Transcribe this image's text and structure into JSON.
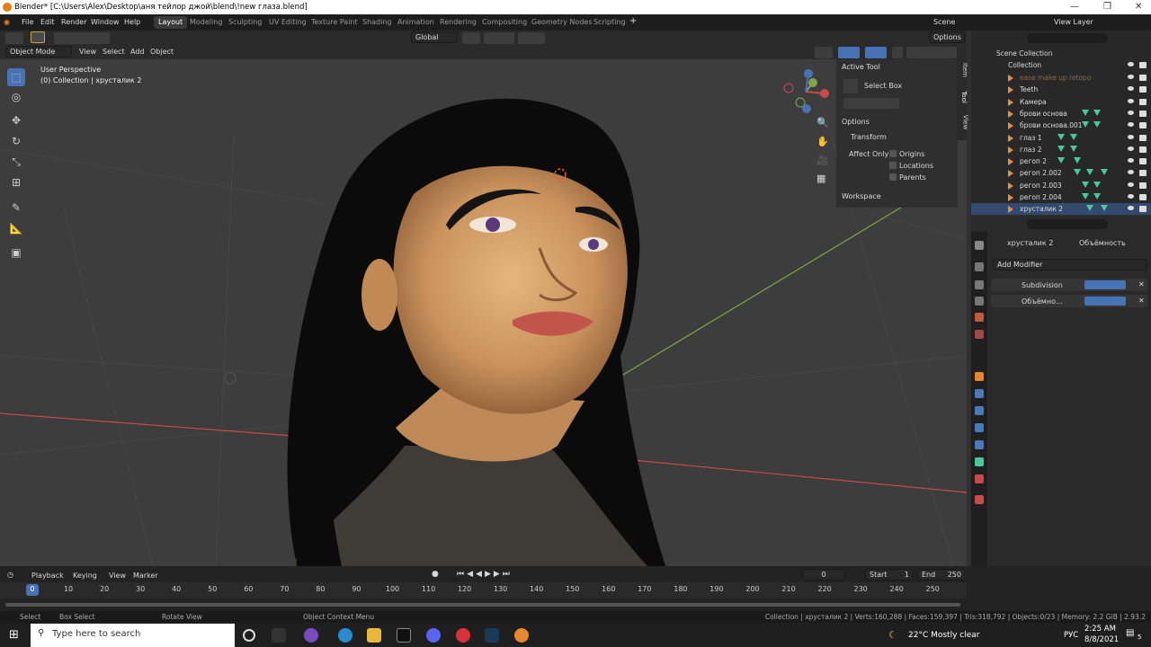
{
  "window": {
    "title": "Blender* [C:\\Users\\Alex\\Desktop\\аня тейлор джой\\blend\\!new глаза.blend]"
  },
  "menu": [
    "File",
    "Edit",
    "Render",
    "Window",
    "Help"
  ],
  "workspaces": [
    "Layout",
    "Modeling",
    "Sculpting",
    "UV Editing",
    "Texture Paint",
    "Shading",
    "Animation",
    "Rendering",
    "Compositing",
    "Geometry Nodes",
    "Scripting"
  ],
  "active_workspace": "Layout",
  "scene": {
    "name": "Scene",
    "view_layer": "View Layer"
  },
  "viewport_header": {
    "transform_orientation": "Global",
    "options": "Options",
    "mode": "Object Mode",
    "menus": [
      "View",
      "Select",
      "Add",
      "Object"
    ]
  },
  "viewport_info": {
    "perspective": "User Perspective",
    "collection": "(0) Collection | хрусталик 2"
  },
  "npanel": {
    "tabs": [
      "Item",
      "Tool",
      "View"
    ],
    "active_tool_header": "Active Tool",
    "active_tool": "Select Box",
    "options_header": "Options",
    "transform_header": "Transform",
    "affect_only_label": "Affect Only",
    "affect_only": [
      "Origins",
      "Locations",
      "Parents"
    ],
    "workspace_header": "Workspace"
  },
  "outliner": {
    "root": "Scene Collection",
    "collection": "Collection",
    "items": [
      "ease make up retopo",
      "Teeth",
      "Камера",
      "брови основа",
      "брови основа.001",
      "глаз 1",
      "глаз 2",
      "регоп 2",
      "регоп 2.002",
      "регоп 2.003",
      "регоп 2.004",
      "хрусталик 2"
    ]
  },
  "properties": {
    "object_name": "хрусталик 2",
    "data_name": "Объёмность",
    "add_modifier": "Add Modifier",
    "modifiers": [
      "Subdivision",
      "Объёмно..."
    ]
  },
  "timeline": {
    "menus": [
      "Playback",
      "Keying",
      "View",
      "Marker"
    ],
    "current_frame": "0",
    "start_label": "Start",
    "start": "1",
    "end_label": "End",
    "end": "250",
    "ticks": [
      "0",
      "10",
      "20",
      "30",
      "40",
      "50",
      "60",
      "70",
      "80",
      "90",
      "100",
      "110",
      "120",
      "130",
      "140",
      "150",
      "160",
      "170",
      "180",
      "190",
      "200",
      "210",
      "220",
      "230",
      "240",
      "250"
    ]
  },
  "statusbar": {
    "select": "Select",
    "box_select": "Box Select",
    "rotate_view": "Rotate View",
    "context_menu": "Object Context Menu",
    "stats": "Collection | хрусталик 2 | Verts:160,288 | Faces:159,397 | Tris:318,792 | Objects:0/23 | Memory: 2.2 GiB | 2.93.2"
  },
  "taskbar": {
    "search_placeholder": "Type here to search",
    "weather": "22°C  Mostly clear",
    "language": "РУС",
    "time": "2:25 AM",
    "date": "8/8/2021",
    "notifications": "5"
  },
  "colors": {
    "accent": "#4772b3",
    "x_axis": "#c84a4a",
    "y_axis": "#7ea84a",
    "orange": "#e8862c",
    "mesh_green": "#49c79d"
  }
}
